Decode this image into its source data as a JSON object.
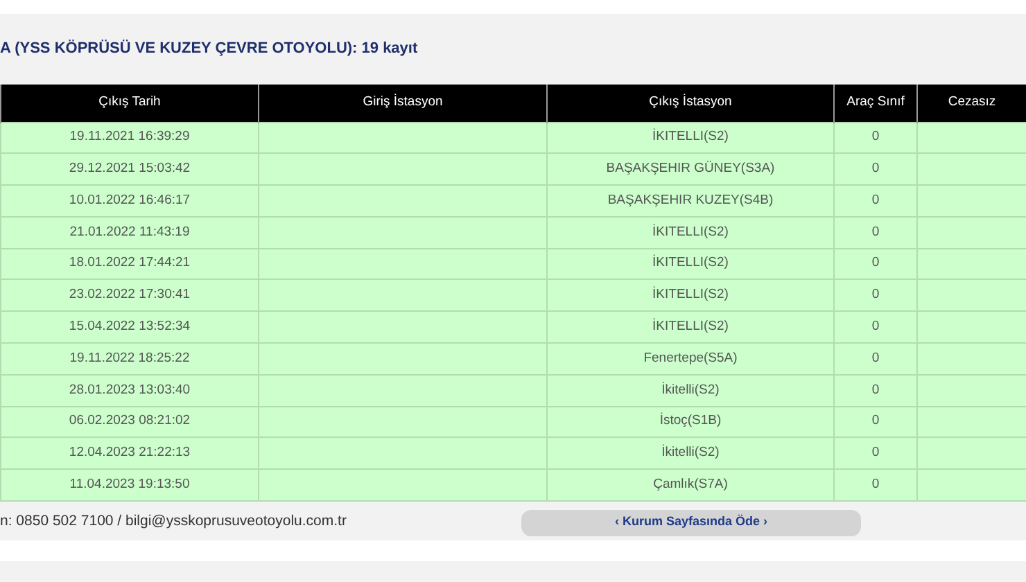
{
  "title": "A (YSS KÖPRÜSÜ VE KUZEY ÇEVRE OTOYOLU): 19 kayıt",
  "table": {
    "columns": [
      "Çıkış Tarih",
      "Giriş İstasyon",
      "Çıkış İstasyon",
      "Araç Sınıf",
      "Cezasız"
    ],
    "rows": [
      [
        "19.11.2021 16:39:29",
        "",
        "İKITELLI(S2)",
        "0",
        ""
      ],
      [
        "29.12.2021 15:03:42",
        "",
        "BAŞAKŞEHIR GÜNEY(S3A)",
        "0",
        ""
      ],
      [
        "10.01.2022 16:46:17",
        "",
        "BAŞAKŞEHIR KUZEY(S4B)",
        "0",
        ""
      ],
      [
        "21.01.2022 11:43:19",
        "",
        "İKITELLI(S2)",
        "0",
        ""
      ],
      [
        "18.01.2022 17:44:21",
        "",
        "İKITELLI(S2)",
        "0",
        ""
      ],
      [
        "23.02.2022 17:30:41",
        "",
        "İKITELLI(S2)",
        "0",
        ""
      ],
      [
        "15.04.2022 13:52:34",
        "",
        "İKITELLI(S2)",
        "0",
        ""
      ],
      [
        "19.11.2022 18:25:22",
        "",
        "Fenertepe(S5A)",
        "0",
        ""
      ],
      [
        "28.01.2023 13:03:40",
        "",
        "İkitelli(S2)",
        "0",
        ""
      ],
      [
        "06.02.2023 08:21:02",
        "",
        "İstoç(S1B)",
        "0",
        ""
      ],
      [
        "12.04.2023 21:22:13",
        "",
        "İkitelli(S2)",
        "0",
        ""
      ],
      [
        "11.04.2023 19:13:50",
        "",
        "Çamlık(S7A)",
        "0",
        ""
      ]
    ]
  },
  "footer": {
    "contact": "n: 0850 502 7100 / bilgi@ysskoprusuveotoyolu.com.tr",
    "pay_button": "‹ Kurum Sayfasında Öde ›"
  }
}
